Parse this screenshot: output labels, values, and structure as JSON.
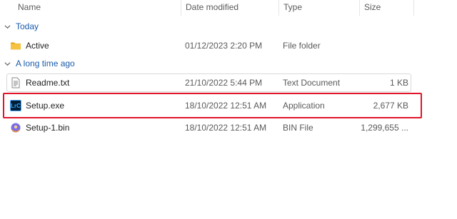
{
  "columns": {
    "name": "Name",
    "date": "Date modified",
    "type": "Type",
    "size": "Size"
  },
  "groups": [
    {
      "label": "Today",
      "files": [
        {
          "name": "Active",
          "date": "01/12/2023 2:20 PM",
          "type": "File folder",
          "size": "",
          "icon": "folder-icon"
        }
      ]
    },
    {
      "label": "A long time ago",
      "files": [
        {
          "name": "Readme.txt",
          "date": "21/10/2022 5:44 PM",
          "type": "Text Document",
          "size": "1 KB",
          "icon": "text-document-icon"
        },
        {
          "name": "Setup.exe",
          "date": "18/10/2022 12:51 AM",
          "type": "Application",
          "size": "2,677 KB",
          "icon": "lightroom-classic-icon",
          "icon_text": "LrC"
        },
        {
          "name": "Setup-1.bin",
          "date": "18/10/2022 12:51 AM",
          "type": "BIN File",
          "size": "1,299,655 ...",
          "icon": "bin-file-icon"
        }
      ]
    }
  ],
  "colors": {
    "group_label": "#1a5bab",
    "highlight": "#e0142a",
    "folder": "#f5c242"
  }
}
